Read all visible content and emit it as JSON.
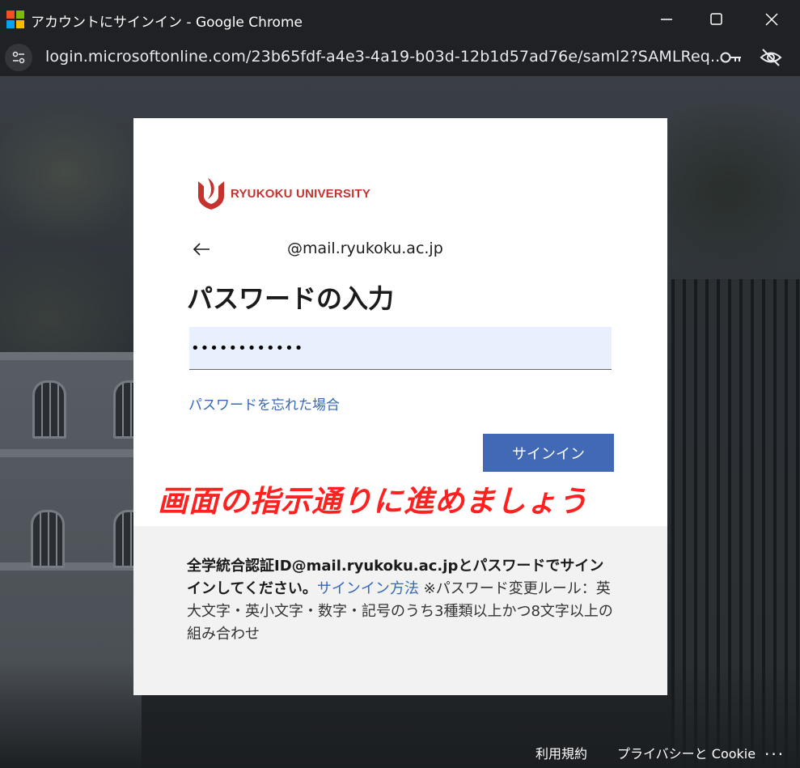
{
  "window": {
    "title": "アカウントにサインイン - Google Chrome",
    "logo_colors": [
      "#f25022",
      "#7fba00",
      "#00a4ef",
      "#ffb900"
    ]
  },
  "addressbar": {
    "url": "login.microsoftonline.com/23b65fdf-a4e3-4a19-b03d-12b1d57ad76e/saml2?SAMLReq..."
  },
  "card": {
    "brand": "RYUKOKU UNIVERSITY",
    "brand_color": "#c5332f",
    "identity": "@mail.ryukoku.ac.jp",
    "heading": "パスワードの入力",
    "password_value": "••••••••••••",
    "forgot_link": "パスワードを忘れた場合",
    "signin_button": "サインイン",
    "accent_color": "#4169b6"
  },
  "annotation": "画面の指示通りに進めましょう",
  "info": {
    "bold_text": "全学統合認証ID@mail.ryukoku.ac.jpとパスワードでサインインしてください。",
    "link_text": "サインイン方法",
    "rule_text": " ※パスワード変更ルール：英大文字・英小文字・数字・記号のうち3種類以上かつ8文字以上の組み合わせ"
  },
  "footer": {
    "terms": "利用規約",
    "privacy": "プライバシーと Cookie",
    "more": "..."
  }
}
